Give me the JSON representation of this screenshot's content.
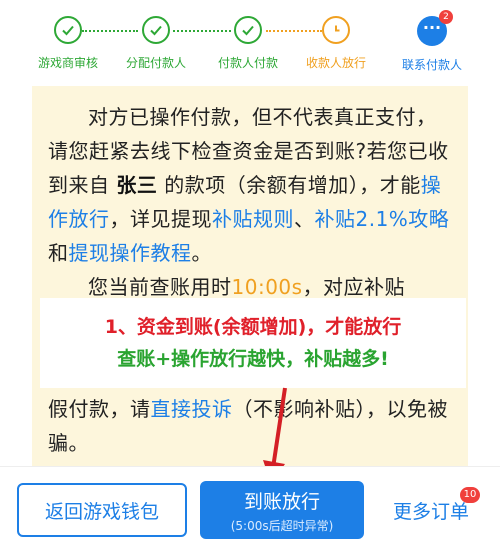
{
  "steps": [
    {
      "label": "游戏商审核",
      "icon": "check-icon",
      "state": "done"
    },
    {
      "label": "分配付款人",
      "icon": "check-icon",
      "state": "done"
    },
    {
      "label": "付款人付款",
      "icon": "check-icon",
      "state": "done"
    },
    {
      "label": "收款人放行",
      "icon": "clock-icon",
      "state": "current"
    }
  ],
  "contact": {
    "label": "联系付款人",
    "icon": "chat-bubble-icon",
    "badge": "2"
  },
  "notice": {
    "p1_a": "对方已操作付款，但不代表真正支付，请您赶紧去线下检查资金是否到账?若您已收到来自 ",
    "payer_name": "张三",
    "p1_b": " 的款项（余额有增加），才能",
    "link_release": "操作放行",
    "p1_c": "，详见提现",
    "link_rules": "补贴规则",
    "p1_d": "、",
    "link_guide": "补贴2.1%攻略",
    "p1_e": "和",
    "link_tutorial": "提现操作教程",
    "p1_f": "。",
    "p2_hidden_prefix": "您当前查账用时",
    "p2_timer": "10:00s",
    "p2_hidden_suffix": "，对应补贴",
    "p3_a": "假付款，请",
    "link_complain": "直接投诉",
    "p3_b": "（不影响补贴），以免被骗。"
  },
  "annotation": {
    "line1": "1、资金到账(余额增加)，才能放行",
    "line2": "查账+操作放行越快，补贴越多!"
  },
  "bottom": {
    "back_label": "返回游戏钱包",
    "release_label": "到账放行",
    "release_sub": "(5:00s后超时异常)",
    "more_label": "更多订单",
    "more_badge": "10"
  },
  "colors": {
    "accent": "#1d7fe6",
    "done": "#2ea836",
    "current": "#f0a020",
    "panel": "#fdf6dc",
    "red": "#e0202a"
  }
}
